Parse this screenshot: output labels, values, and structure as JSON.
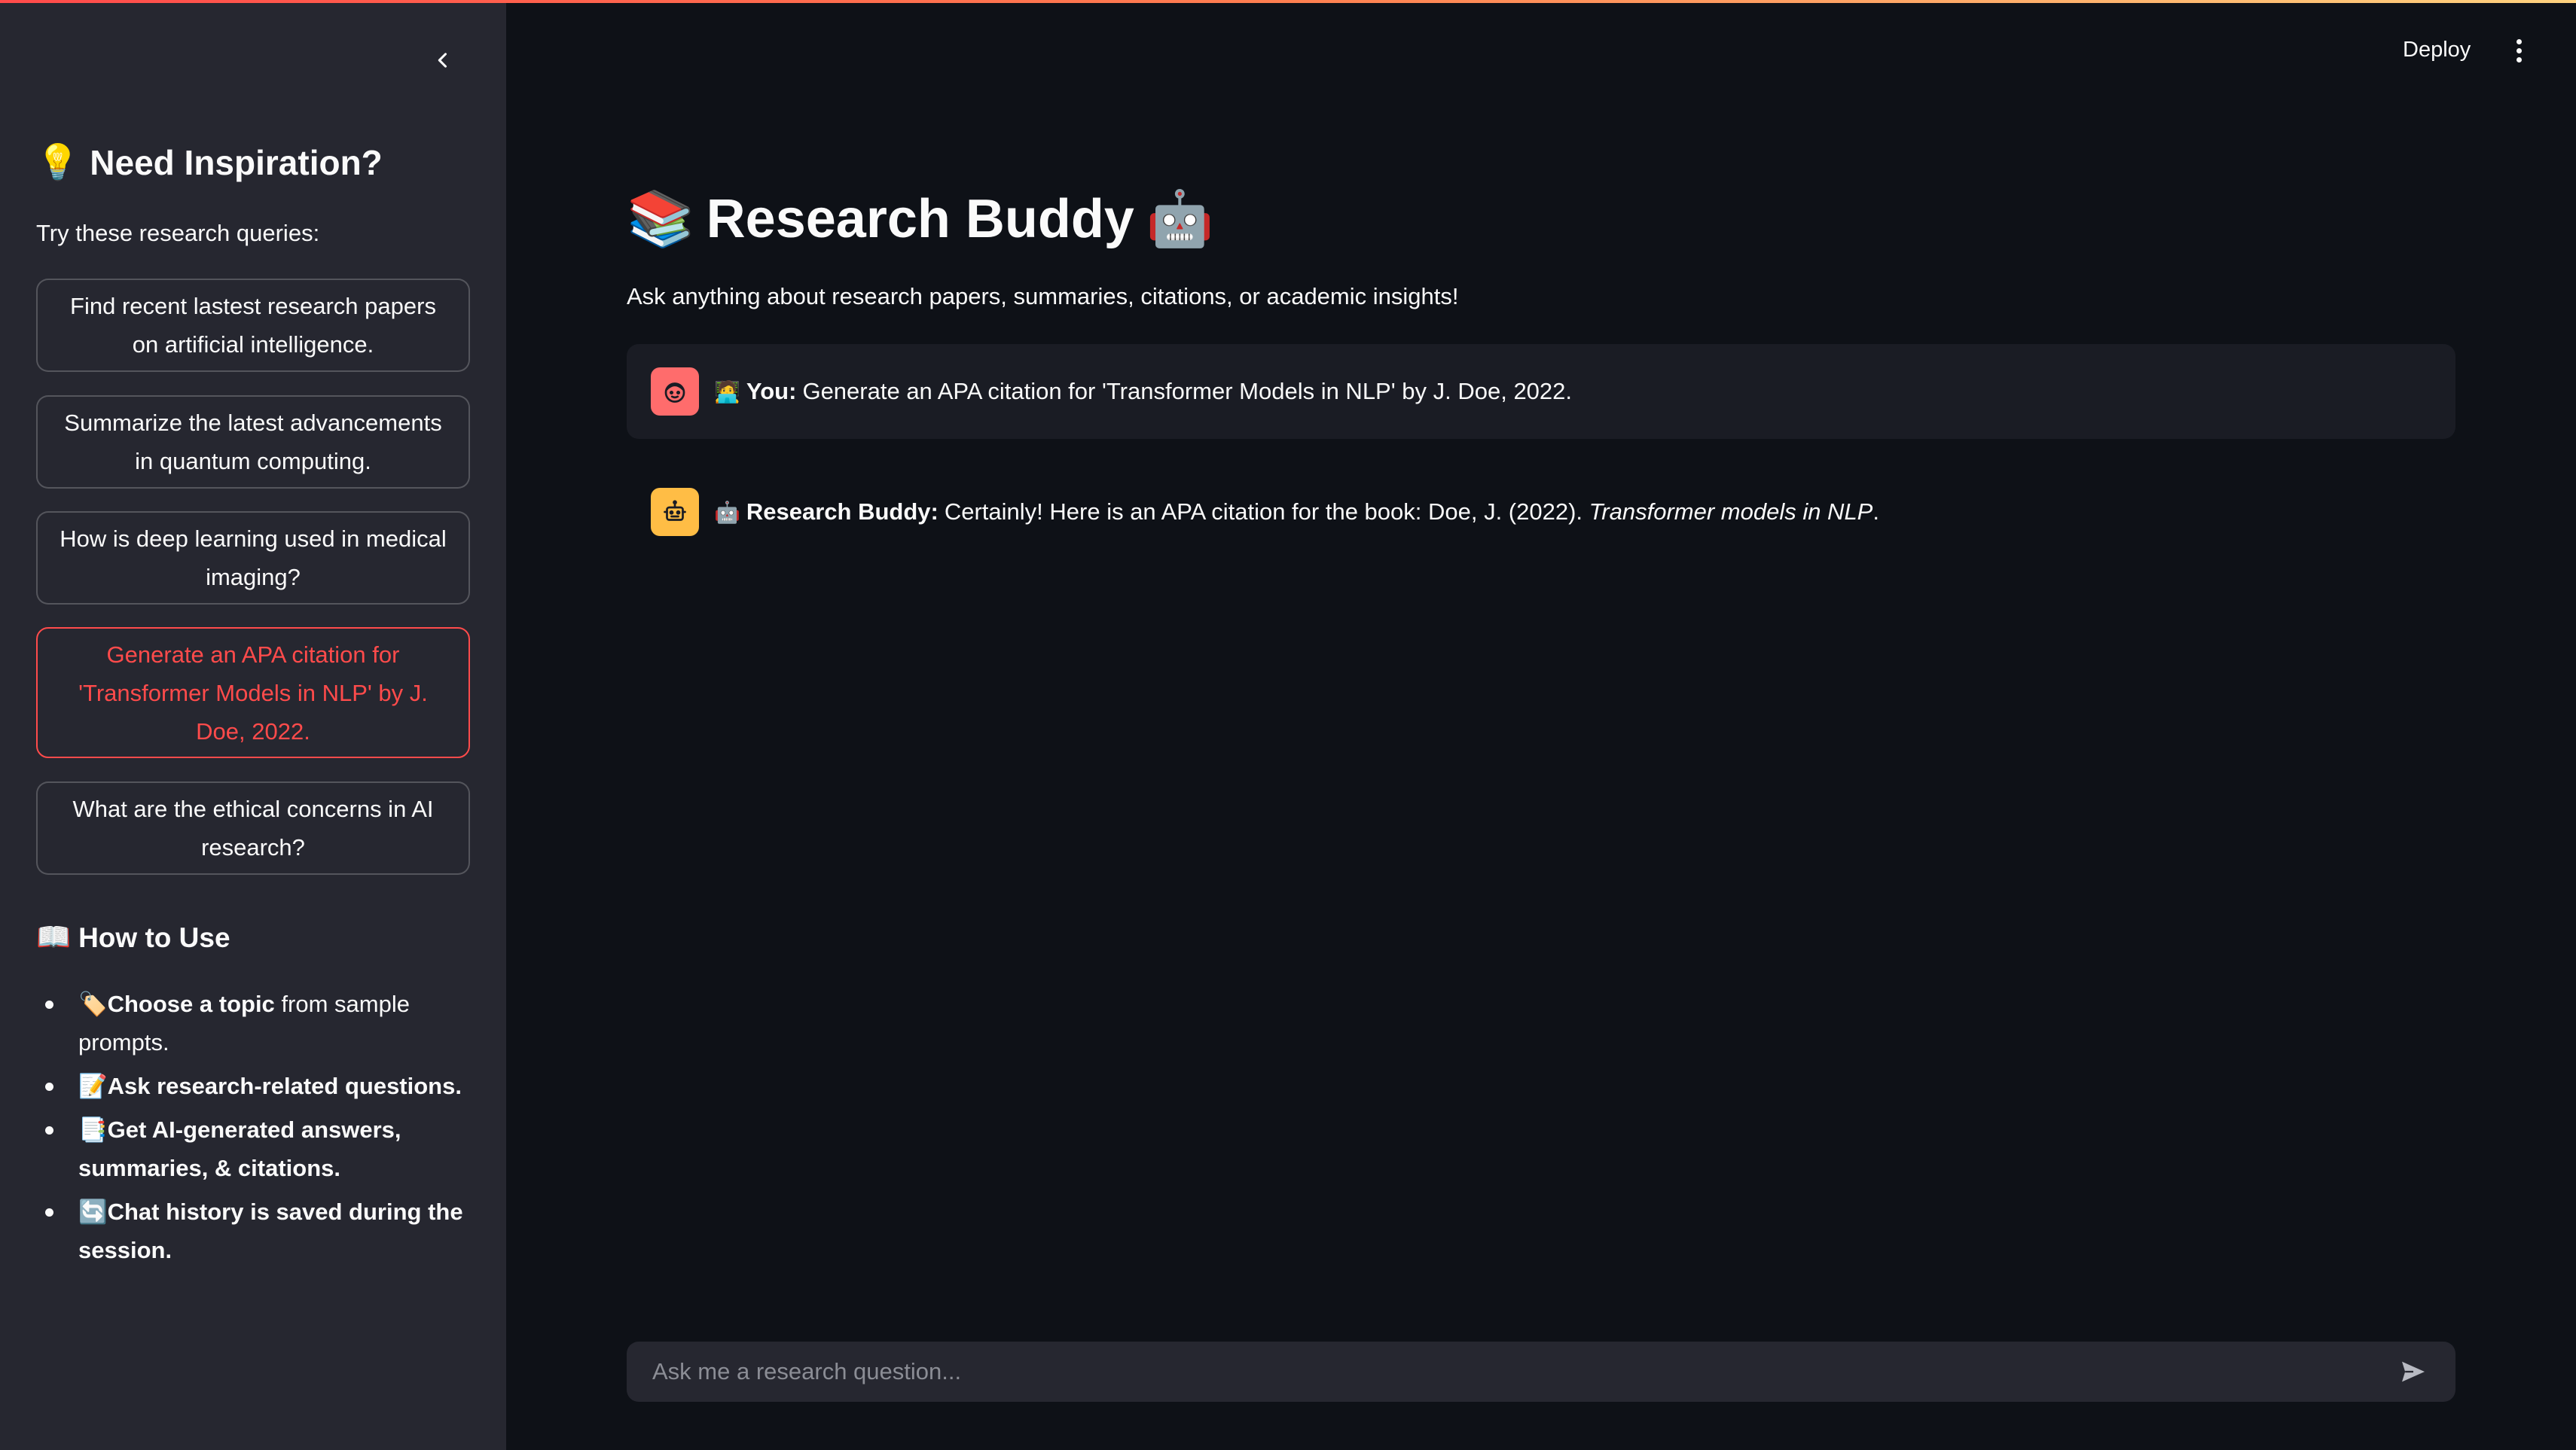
{
  "colors": {
    "background": "#0e1117",
    "sidebar": "#262730",
    "accent": "#ff4b4b",
    "user_avatar": "#ff6c6c",
    "bot_avatar": "#ffbd45"
  },
  "sidebar": {
    "collapse_icon": "chevron-left-icon",
    "title_icon": "💡",
    "title": "Need Inspiration?",
    "subtitle": "Try these research queries:",
    "prompts": [
      {
        "label": "Find recent lastest research papers on artificial intelligence."
      },
      {
        "label": "Summarize the latest advancements in quantum computing."
      },
      {
        "label": "How is deep learning used in medical imaging?"
      },
      {
        "label": "Generate an APA citation for 'Transformer Models in NLP' by J. Doe, 2022.",
        "active": true
      },
      {
        "label": "What are the ethical concerns in AI research?"
      }
    ],
    "howto": {
      "icon": "📖",
      "title": "How to Use",
      "items": [
        {
          "icon": "🏷️",
          "bold": "Choose a topic",
          "rest": "from sample prompts."
        },
        {
          "icon": "📝",
          "bold": "Ask research-related questions.",
          "rest": ""
        },
        {
          "icon": "📑",
          "bold": "Get AI-generated answers, summaries, & citations.",
          "rest": ""
        },
        {
          "icon": "🔄",
          "bold": "Chat history is saved during the session.",
          "rest": ""
        }
      ]
    }
  },
  "header": {
    "deploy_label": "Deploy",
    "menu_icon": "more-vertical-icon"
  },
  "main": {
    "title_icon_left": "📚",
    "title": "Research Buddy",
    "title_icon_right": "🤖",
    "subtitle": "Ask anything about research papers, summaries, citations, or academic insights!"
  },
  "messages": [
    {
      "role": "user",
      "emoji": "🧑‍💻",
      "speaker": "You:",
      "text": "Generate an APA citation for 'Transformer Models in NLP' by J. Doe, 2022."
    },
    {
      "role": "assistant",
      "emoji": "🤖",
      "speaker": "Research Buddy:",
      "text": "Certainly! Here is an APA citation for the book: Doe, J. (2022).",
      "italic": "Transformer models in NLP",
      "end": "."
    }
  ],
  "chat_input": {
    "placeholder": "Ask me a research question...",
    "send_icon": "send-icon"
  }
}
